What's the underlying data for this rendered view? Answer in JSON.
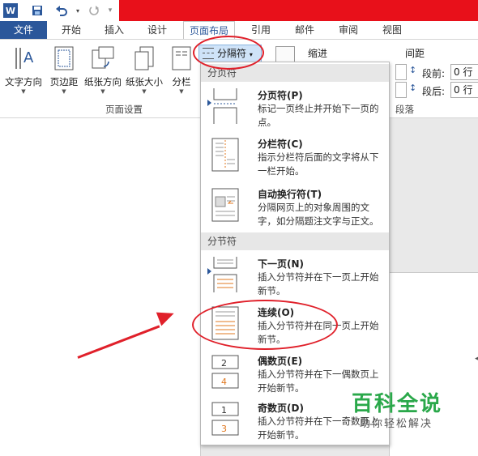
{
  "quick_access": {
    "logo": "W",
    "save_icon": "save-icon",
    "undo_icon": "undo-icon",
    "redo_icon": "redo-icon"
  },
  "tabs": {
    "file": "文件",
    "home": "开始",
    "insert": "插入",
    "design": "设计",
    "layout": "页面布局",
    "references": "引用",
    "mailings": "邮件",
    "review": "审阅",
    "view": "视图"
  },
  "ribbon": {
    "text_direction": "文字方向",
    "margins": "页边距",
    "orientation": "纸张方向",
    "size": "纸张大小",
    "columns": "分栏",
    "page_setup_group": "页面设置",
    "breaks_button": "分隔符",
    "indent_label": "缩进",
    "spacing_label": "间距",
    "before_label": "段前:",
    "after_label": "段后:",
    "before_value": "0 行",
    "after_value": "0 行",
    "paragraph_group": "段落"
  },
  "menu": {
    "page_breaks_header": "分页符",
    "section_breaks_header": "分节符",
    "items": [
      {
        "title": "分页符(P)",
        "desc": "标记一页终止并开始下一页的点。"
      },
      {
        "title": "分栏符(C)",
        "desc": "指示分栏符后面的文字将从下一栏开始。"
      },
      {
        "title": "自动换行符(T)",
        "desc": "分隔网页上的对象周围的文字，如分隔题注文字与正文。"
      },
      {
        "title": "下一页(N)",
        "desc": "插入分节符并在下一页上开始新节。"
      },
      {
        "title": "连续(O)",
        "desc": "插入分节符并在同一页上开始新节。"
      },
      {
        "title": "偶数页(E)",
        "desc": "插入分节符并在下一偶数页上开始新节。"
      },
      {
        "title": "奇数页(D)",
        "desc": "插入分节符并在下一奇数页上开始新节。"
      }
    ]
  },
  "watermark": {
    "title": "百科全说",
    "subtitle": "助你轻松解决"
  },
  "colors": {
    "accent": "#2b579a",
    "annotation": "#e0202a",
    "title_bar": "#e8101a",
    "watermark": "#2aa84a"
  }
}
